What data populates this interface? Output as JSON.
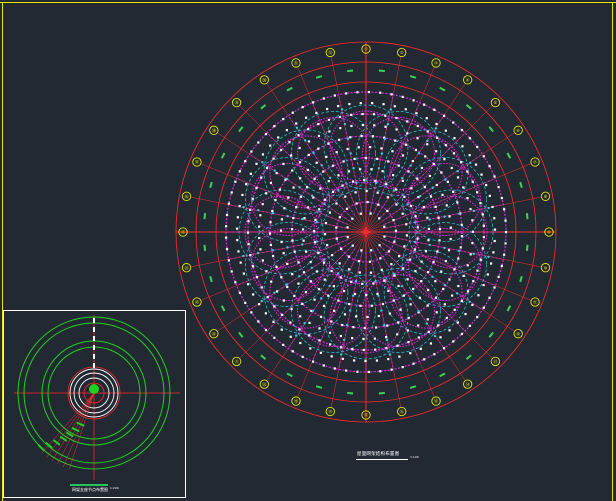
{
  "colors": {
    "background": "#222933",
    "frame": "#e6e600",
    "axis": "#ff2a2a",
    "member_primary": "#d92ad9",
    "member_secondary": "#23d4e0",
    "node": "#ffffff",
    "bubble": "#e6e600",
    "keyplan_ring": "#1fd11f",
    "keyplan_inner": "#ffffff"
  },
  "drawing": {
    "title": "屋面网架结构布置图",
    "scale": "1:100"
  },
  "keyplan": {
    "title": "网架支座节点布置图",
    "scale": "1:200"
  },
  "axis_bubbles": [
    "①",
    "②",
    "③",
    "④",
    "⑤",
    "⑥",
    "⑦",
    "⑧",
    "⑨",
    "⑩",
    "⑪",
    "⑫",
    "⑬",
    "⑭",
    "⑮",
    "⑯",
    "⑰",
    "⑱",
    "⑲",
    "⑳",
    "㉑",
    "㉒",
    "㉓",
    "㉔",
    "㉕",
    "㉖",
    "㉗",
    "㉘",
    "㉙",
    "㉚",
    "㉛",
    "㉜"
  ]
}
